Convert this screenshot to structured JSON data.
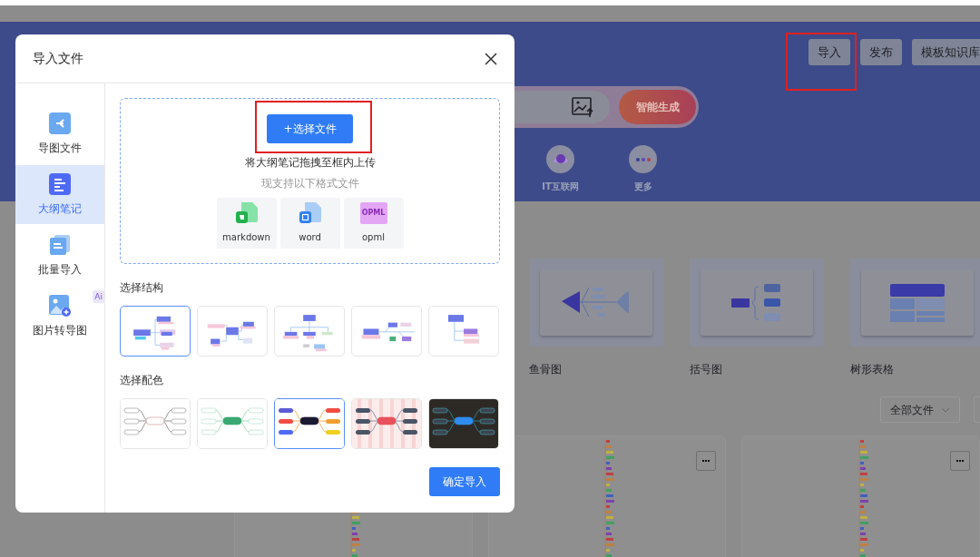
{
  "background_page": {
    "header_buttons": [
      {
        "label": "导入",
        "highlighted": true
      },
      {
        "label": "发布",
        "highlighted": false
      },
      {
        "label": "模板知识库",
        "highlighted": false
      }
    ],
    "generate_button": "智能生成",
    "categories": [
      {
        "label": "IT互联网",
        "kind": "planet"
      },
      {
        "label": "更多",
        "kind": "more"
      }
    ],
    "templates": [
      {
        "label": "鱼骨图",
        "kind": "fishbone"
      },
      {
        "label": "括号图",
        "kind": "bracket"
      },
      {
        "label": "树形表格",
        "kind": "tree-table"
      }
    ],
    "file_filter": "全部文件"
  },
  "dialog": {
    "title": "导入文件",
    "sidebar": [
      {
        "label": "导图文件",
        "kind": "mindmap",
        "selected": false
      },
      {
        "label": "大纲笔记",
        "kind": "outline",
        "selected": true
      },
      {
        "label": "批量导入",
        "kind": "batch",
        "selected": false
      },
      {
        "label": "图片转导图",
        "kind": "image",
        "selected": false,
        "badge": "Ai"
      }
    ],
    "upload": {
      "button": "+选择文件",
      "highlighted": true,
      "hint": "将大纲笔记拖拽至框内上传",
      "formats_note": "现支持以下格式文件",
      "formats": [
        {
          "label": "markdown",
          "kind": "markdown"
        },
        {
          "label": "word",
          "kind": "word"
        },
        {
          "label": "opml",
          "kind": "opml",
          "icon_text": "OPML"
        }
      ]
    },
    "structure": {
      "title": "选择结构",
      "options": [
        {
          "kind": "logic",
          "selected": true
        },
        {
          "kind": "mindmap",
          "selected": false
        },
        {
          "kind": "org",
          "selected": false
        },
        {
          "kind": "timeline",
          "selected": false
        },
        {
          "kind": "tree",
          "selected": false
        }
      ]
    },
    "palette": {
      "title": "选择配色",
      "options": [
        {
          "kind": "outline",
          "selected": false
        },
        {
          "kind": "green",
          "selected": false
        },
        {
          "kind": "colorful",
          "selected": true
        },
        {
          "kind": "striped",
          "selected": false
        },
        {
          "kind": "dark",
          "selected": false
        }
      ]
    },
    "confirm_button": "确定导入"
  }
}
